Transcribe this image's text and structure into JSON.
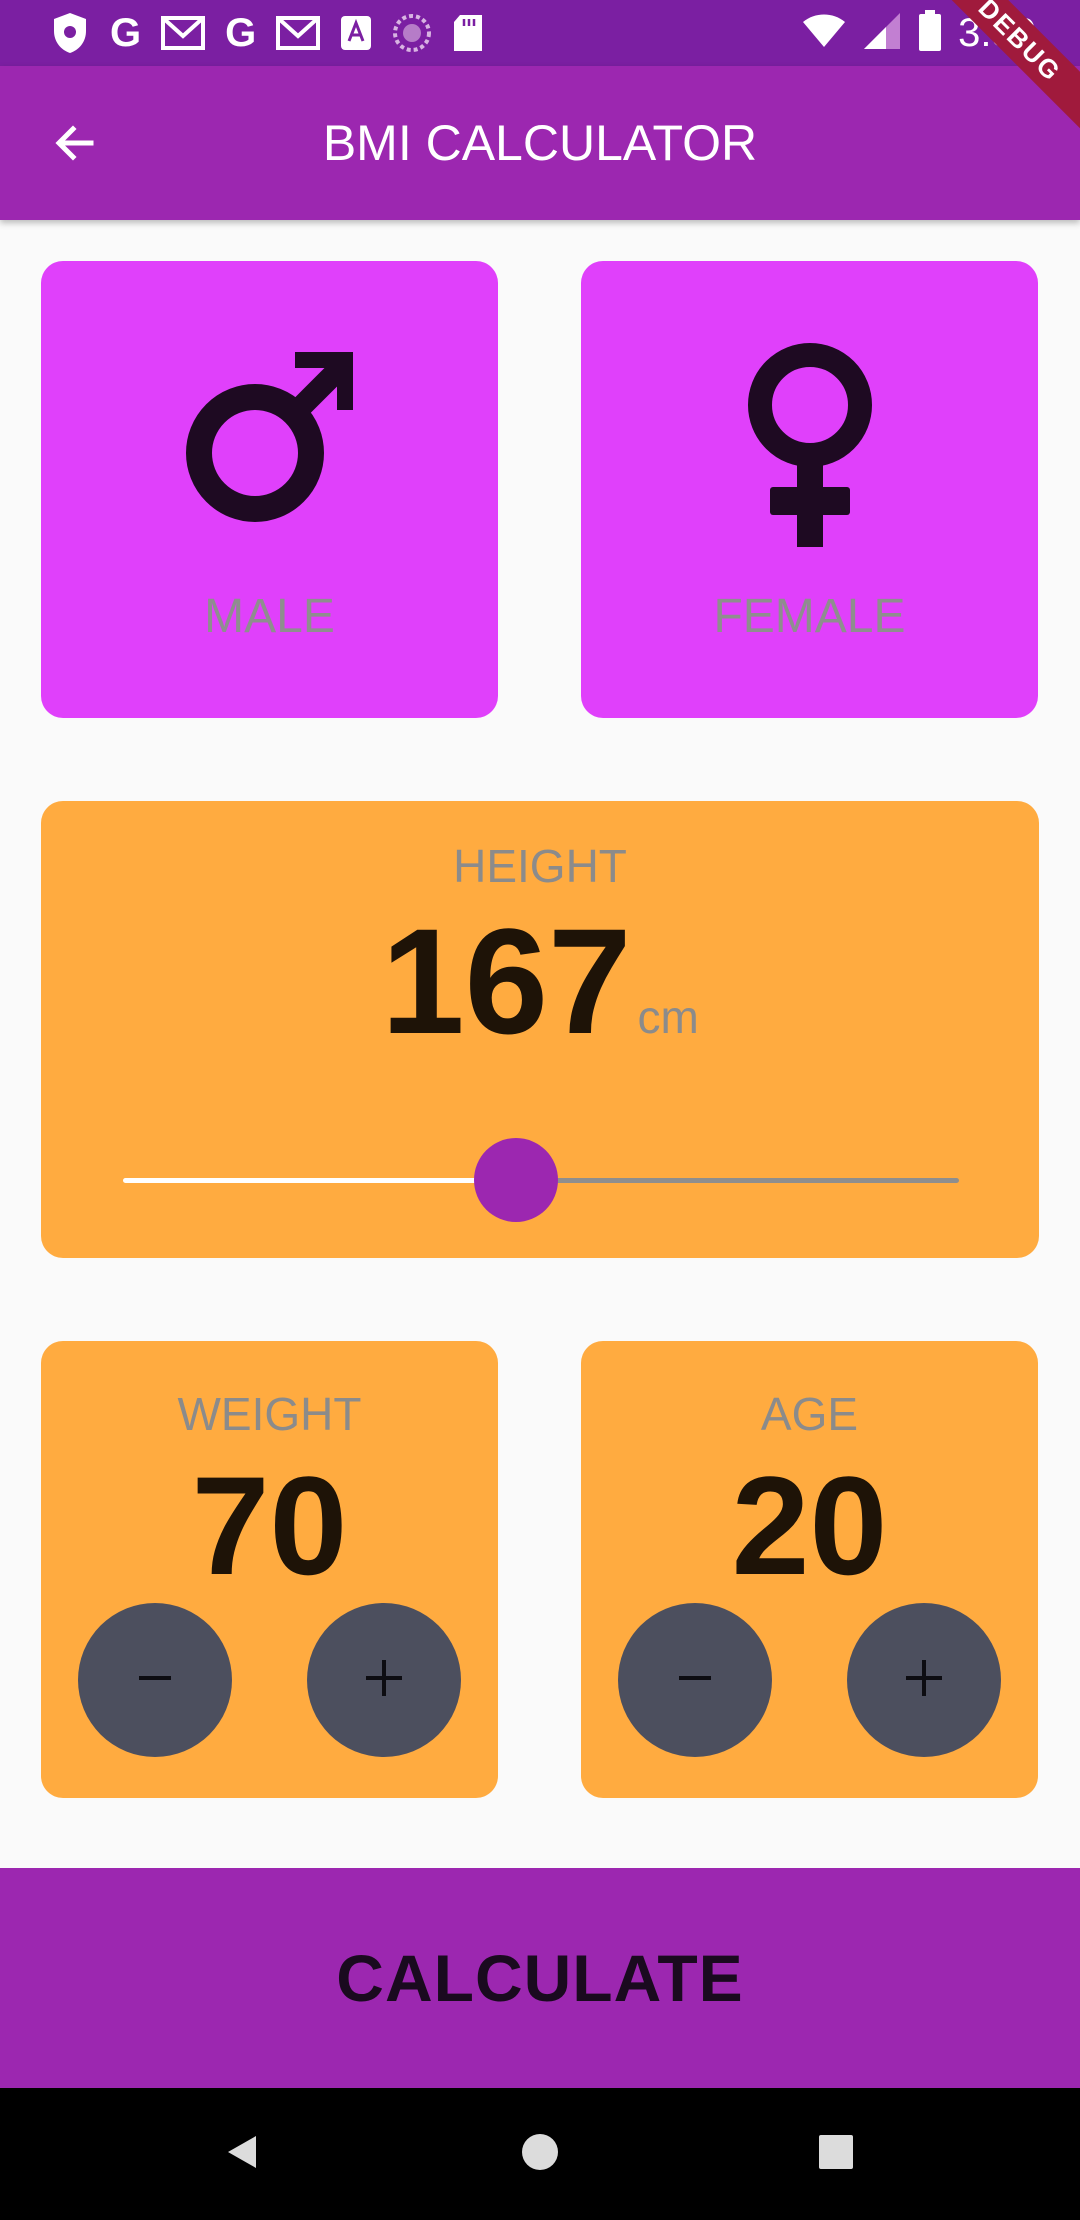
{
  "status_bar": {
    "time": "3:30",
    "left_icons": [
      "shield-icon",
      "google-icon",
      "gmail-icon",
      "google-icon",
      "gmail-icon",
      "text-badge-icon",
      "sync-icon",
      "sd-card-icon"
    ],
    "right_icons": [
      "wifi-icon",
      "signal-icon",
      "battery-icon"
    ]
  },
  "app_bar": {
    "title": "BMI CALCULATOR",
    "back_icon": "arrow-back-icon",
    "debug_banner": "DEBUG",
    "color": "#9c27b0"
  },
  "gender": {
    "male_label": "MALE",
    "female_label": "FEMALE",
    "male_icon": "male-symbol-icon",
    "female_icon": "female-symbol-icon",
    "card_color": "#e040fb"
  },
  "height": {
    "label": "HEIGHT",
    "value": "167",
    "unit": "cm",
    "slider_fraction": 0.47
  },
  "weight": {
    "label": "WEIGHT",
    "value": "70",
    "minus_icon": "minus-icon",
    "plus_icon": "plus-icon"
  },
  "age": {
    "label": "AGE",
    "value": "20",
    "minus_icon": "minus-icon",
    "plus_icon": "plus-icon"
  },
  "calculate": {
    "label": "CALCULATE"
  },
  "nav_bar": {
    "icons": [
      "nav-back-icon",
      "nav-home-icon",
      "nav-recents-icon"
    ]
  },
  "colors": {
    "accent": "#9c27b0",
    "card_active": "#ffab40",
    "button_dark": "#4c4f5e"
  }
}
